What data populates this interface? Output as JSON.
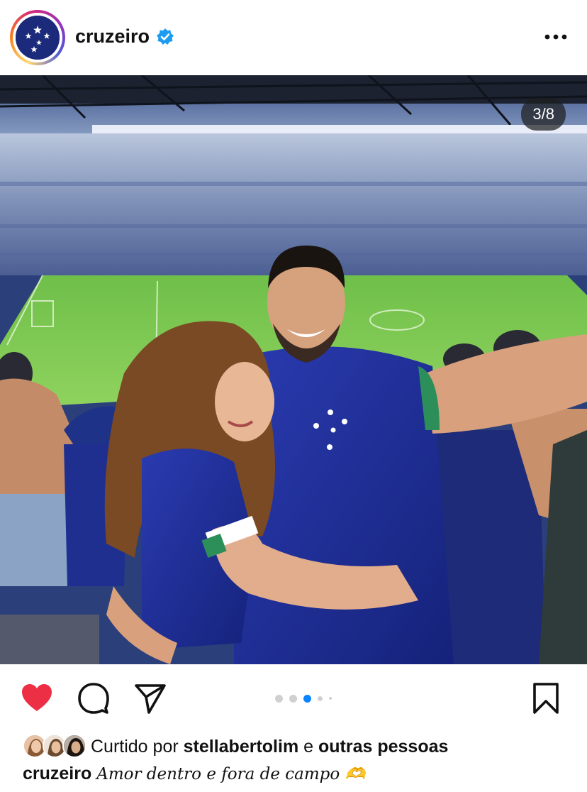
{
  "post": {
    "username": "cruzeiro",
    "verified_icon": "verified-badge-icon",
    "more_icon": "more-options-icon",
    "carousel_counter": "3/8",
    "carousel": {
      "total_dots": 5,
      "active_index": 2
    },
    "likes": {
      "prefix": "Curtido por",
      "liker": "stellabertolim",
      "connector": "e",
      "others": "outras pessoas"
    },
    "caption": {
      "username": "cruzeiro",
      "text": "Amor dentro e fora de campo 🫶"
    }
  },
  "actions": {
    "like_icon": "heart-filled-icon",
    "comment_icon": "comment-icon",
    "share_icon": "send-icon",
    "save_icon": "bookmark-icon"
  },
  "colors": {
    "like_red": "#ed2f45",
    "dot_active": "#0a84ff",
    "verified_blue": "#1d9bf0",
    "club_blue": "#1b2a7a"
  }
}
